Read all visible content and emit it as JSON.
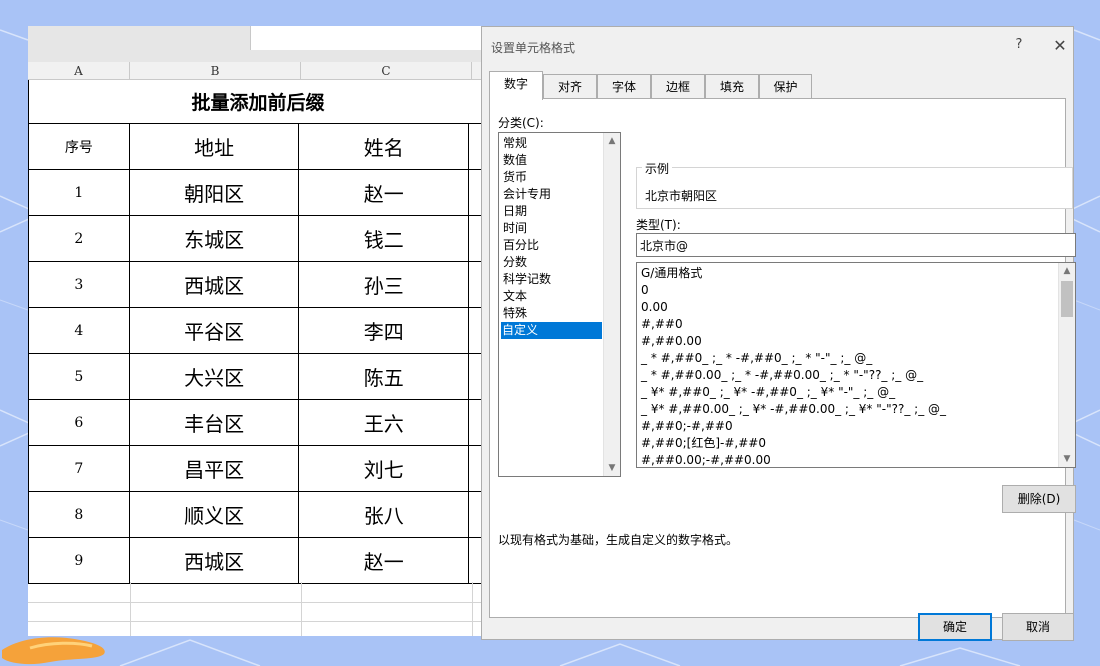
{
  "sheet": {
    "columns": [
      "A",
      "B",
      "C"
    ],
    "title": "批量添加前后缀",
    "headers": [
      "序号",
      "地址",
      "姓名"
    ],
    "rows": [
      {
        "seq": "1",
        "addr": "朝阳区",
        "name": "赵一"
      },
      {
        "seq": "2",
        "addr": "东城区",
        "name": "钱二"
      },
      {
        "seq": "3",
        "addr": "西城区",
        "name": "孙三"
      },
      {
        "seq": "4",
        "addr": "平谷区",
        "name": "李四"
      },
      {
        "seq": "5",
        "addr": "大兴区",
        "name": "陈五"
      },
      {
        "seq": "6",
        "addr": "丰台区",
        "name": "王六"
      },
      {
        "seq": "7",
        "addr": "昌平区",
        "name": "刘七"
      },
      {
        "seq": "8",
        "addr": "顺义区",
        "name": "张八"
      },
      {
        "seq": "9",
        "addr": "西城区",
        "name": "赵一"
      }
    ]
  },
  "dialog": {
    "title": "设置单元格格式",
    "help": "?",
    "close": "✕",
    "tabs": [
      "数字",
      "对齐",
      "字体",
      "边框",
      "填充",
      "保护"
    ],
    "active_tab": "数字",
    "category_label": "分类(C):",
    "categories": [
      "常规",
      "数值",
      "货币",
      "会计专用",
      "日期",
      "时间",
      "百分比",
      "分数",
      "科学记数",
      "文本",
      "特殊",
      "自定义"
    ],
    "selected_category": "自定义",
    "sample_label": "示例",
    "sample_value": "北京市朝阳区",
    "type_label": "类型(T):",
    "type_value": "北京市@",
    "formats": [
      "G/通用格式",
      "0",
      "0.00",
      "#,##0",
      "#,##0.00",
      "_ * #,##0_ ;_ * -#,##0_ ;_ * \"-\"_ ;_ @_",
      "_ * #,##0.00_ ;_ * -#,##0.00_ ;_ * \"-\"??_ ;_ @_",
      "_ ¥* #,##0_ ;_ ¥* -#,##0_ ;_ ¥* \"-\"_ ;_ @_",
      "_ ¥* #,##0.00_ ;_ ¥* -#,##0.00_ ;_ ¥* \"-\"??_ ;_ @_",
      "#,##0;-#,##0",
      "#,##0;[红色]-#,##0",
      "#,##0.00;-#,##0.00"
    ],
    "delete_button": "删除(D)",
    "description": "以现有格式为基础，生成自定义的数字格式。",
    "ok_button": "确定",
    "cancel_button": "取消"
  },
  "colors": {
    "background": "#a9c3f6",
    "selection": "#0078d7",
    "dialog_bg": "#f0f0f0"
  }
}
